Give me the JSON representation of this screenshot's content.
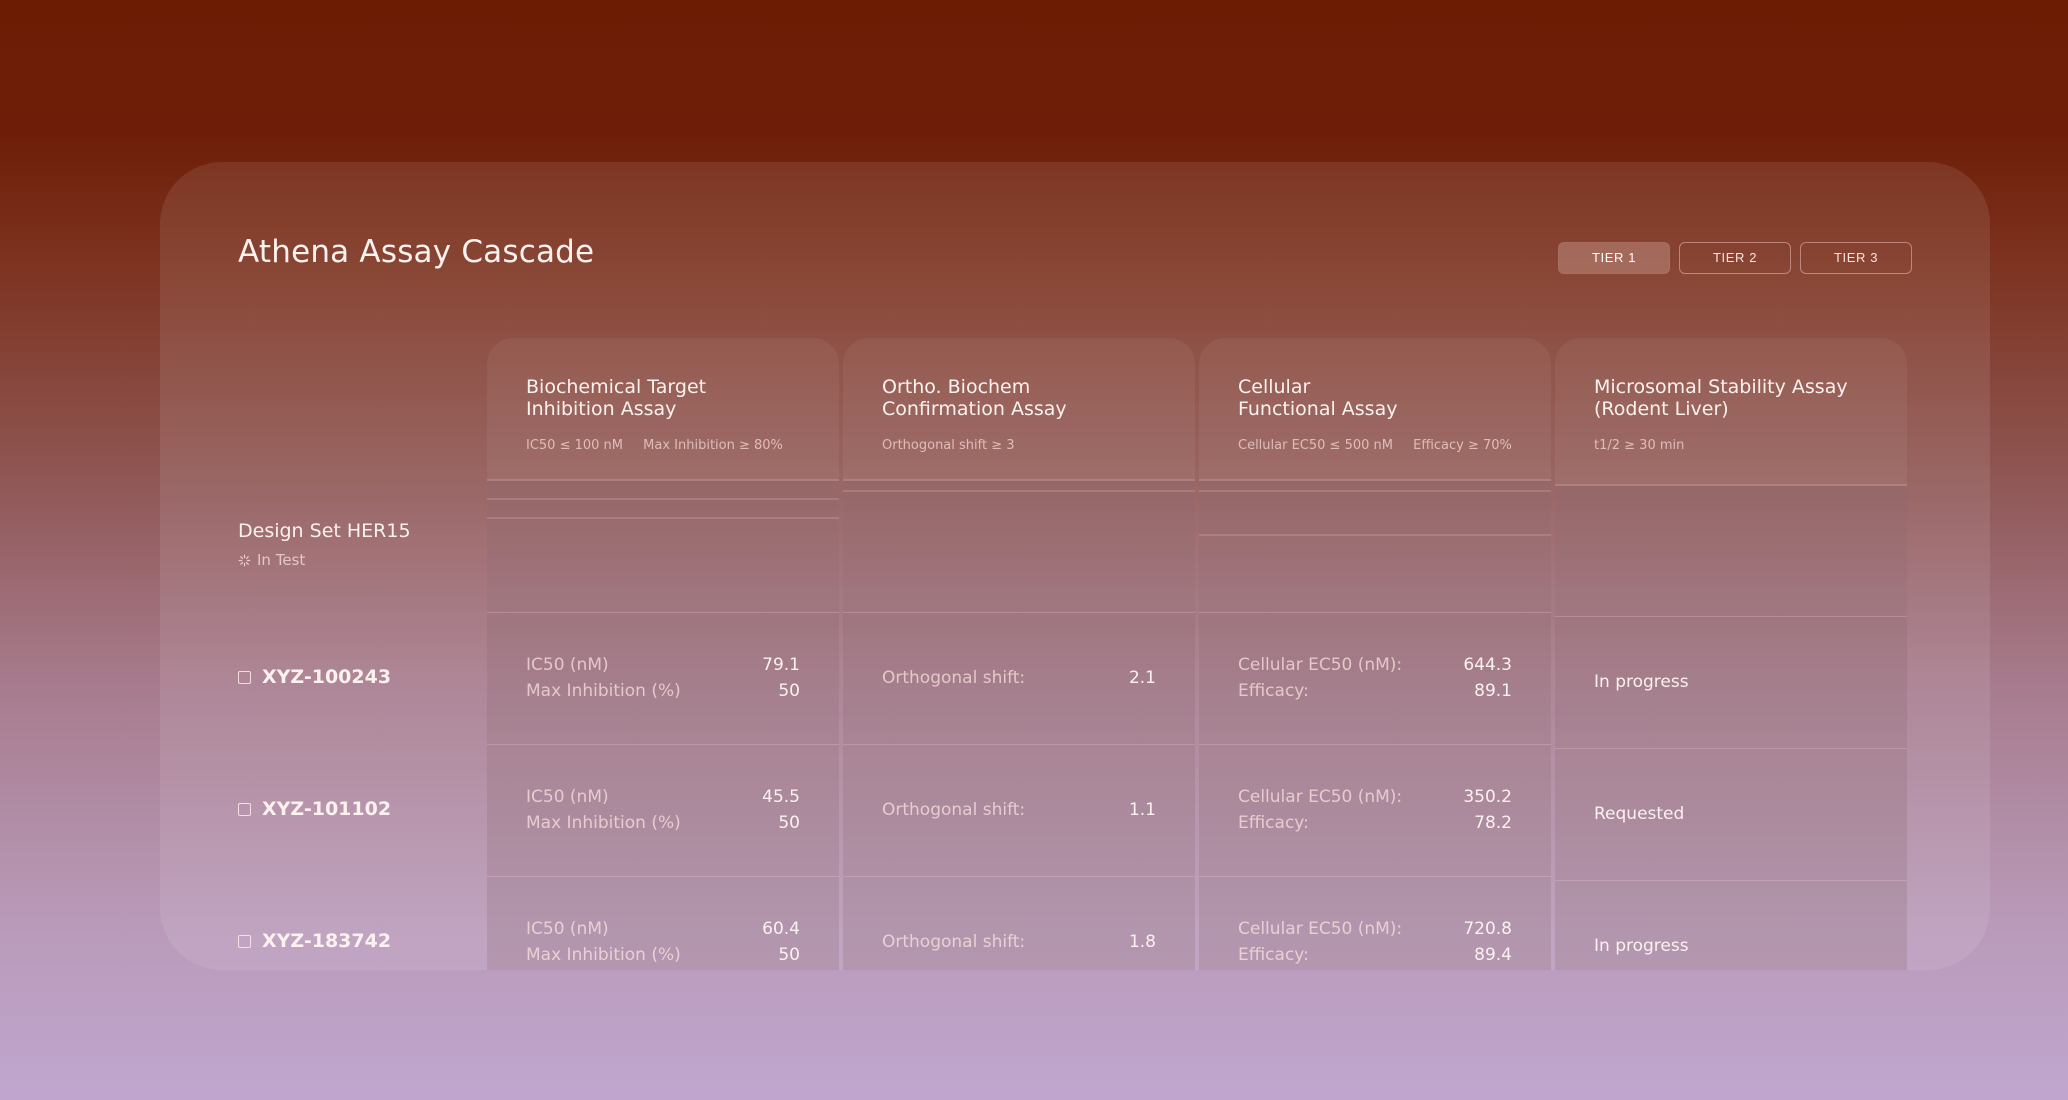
{
  "app": {
    "title": "Athena Assay Cascade"
  },
  "tabs": [
    {
      "label": "TIER 1",
      "active": true
    },
    {
      "label": "TIER 2",
      "active": false
    },
    {
      "label": "TIER 3",
      "active": false
    }
  ],
  "design_set": {
    "name": "Design Set HER15",
    "status": "In Test"
  },
  "compounds": [
    {
      "id": "XYZ-100243"
    },
    {
      "id": "XYZ-101102"
    },
    {
      "id": "XYZ-183742"
    }
  ],
  "assays": [
    {
      "title": "Biochemical Target\nInhibition Assay",
      "criteria": [
        "IC50 ≤ 100 nM",
        "Max Inhibition ≥ 80%"
      ],
      "results": [
        {
          "labels": [
            "IC50 (nM)",
            "Max Inhibition (%)"
          ],
          "values": [
            "79.1",
            "50"
          ]
        },
        {
          "labels": [
            "IC50 (nM)",
            "Max Inhibition (%)"
          ],
          "values": [
            "45.5",
            "50"
          ]
        },
        {
          "labels": [
            "IC50 (nM)",
            "Max Inhibition (%)"
          ],
          "values": [
            "60.4",
            "50"
          ]
        }
      ]
    },
    {
      "title": "Ortho. Biochem\nConfirmation Assay",
      "criteria": [
        "Orthogonal shift ≥ 3"
      ],
      "results": [
        {
          "labels": [
            "Orthogonal shift:"
          ],
          "values": [
            "2.1"
          ]
        },
        {
          "labels": [
            "Orthogonal shift:"
          ],
          "values": [
            "1.1"
          ]
        },
        {
          "labels": [
            "Orthogonal shift:"
          ],
          "values": [
            "1.8"
          ]
        }
      ]
    },
    {
      "title": "Cellular\nFunctional Assay",
      "criteria": [
        "Cellular EC50 ≤ 500 nM",
        "Efficacy ≥ 70%"
      ],
      "results": [
        {
          "labels": [
            "Cellular EC50 (nM):",
            "Efficacy:"
          ],
          "values": [
            "644.3",
            "89.1"
          ]
        },
        {
          "labels": [
            "Cellular EC50 (nM):",
            "Efficacy:"
          ],
          "values": [
            "350.2",
            "78.2"
          ]
        },
        {
          "labels": [
            "Cellular EC50 (nM):",
            "Efficacy:"
          ],
          "values": [
            "720.8",
            "89.4"
          ]
        }
      ]
    },
    {
      "title": "Microsomal Stability Assay\n(Rodent Liver)",
      "criteria": [
        "t1/2 ≥ 30 min"
      ],
      "results": [
        {
          "status": "In progress"
        },
        {
          "status": "Requested"
        },
        {
          "status": "In progress"
        }
      ]
    }
  ]
}
